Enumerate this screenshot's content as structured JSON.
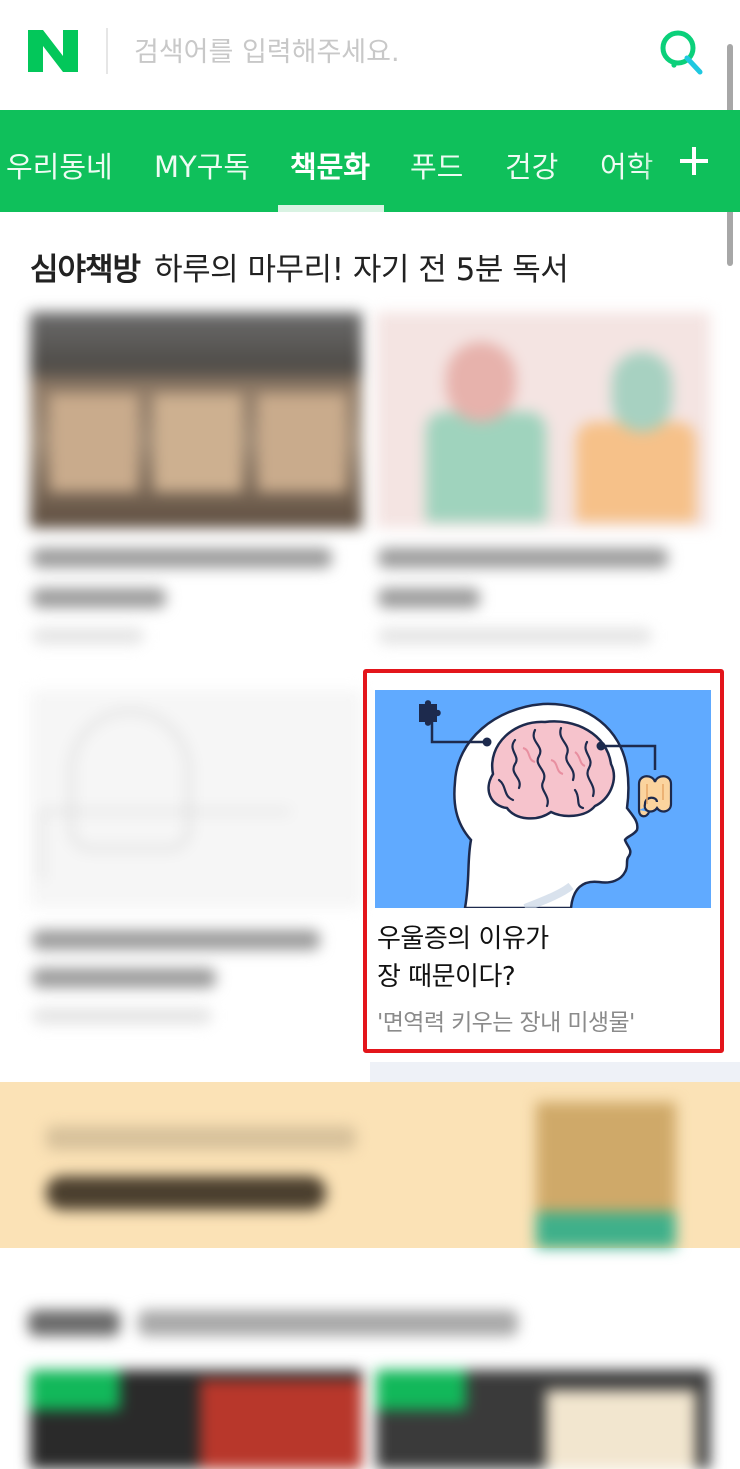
{
  "header": {
    "logo_text": "N",
    "search_placeholder": "검색어를 입력해주세요.",
    "search_icon": "search-icon",
    "colors": {
      "brand": "#03c75a",
      "logo": "#03c75a"
    }
  },
  "nav": {
    "tabs": [
      {
        "label": "우리동네",
        "active": false
      },
      {
        "label": "MY구독",
        "active": false
      },
      {
        "label": "책문화",
        "active": true
      },
      {
        "label": "푸드",
        "active": false
      },
      {
        "label": "건강",
        "active": false
      },
      {
        "label": "어학",
        "active": false
      }
    ],
    "add_icon": "plus-icon",
    "colors": {
      "background": "#0fc05b",
      "text": "#ffffff"
    }
  },
  "section": {
    "title_strong": "심야책방",
    "title_sub": "하루의 마무리! 자기 전 5분 독서"
  },
  "featured_card": {
    "title_line1": "우울증의 이유가",
    "title_line2": "장 때문이다?",
    "subtitle": "'면역력 키우는 장내 미생물'",
    "thumbnail_icons": [
      "puzzle-icon",
      "brain-icon",
      "intestine-icon"
    ],
    "colors": {
      "highlight_border": "#e3151b",
      "thumb_background": "#60aaff"
    }
  }
}
